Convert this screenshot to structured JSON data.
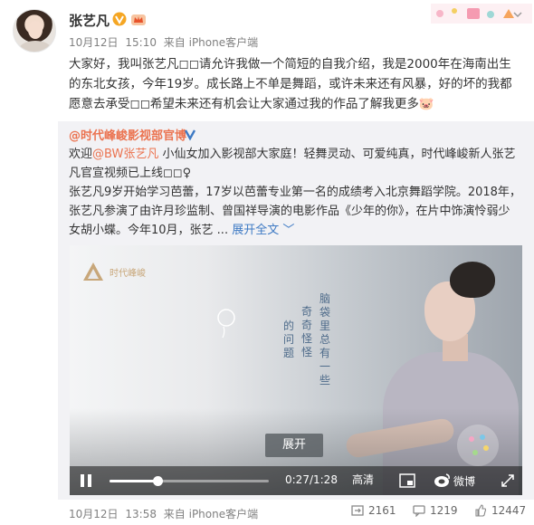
{
  "post": {
    "user_name": "张艺凡",
    "date": "10月12日",
    "time": "15:10",
    "source": "来自 iPhone客户端",
    "text": "大家好，我叫张艺凡◻◻请允许我做一个简短的自我介绍，我是2000年在海南出生的东北女孩，今年19岁。成长路上不单是舞蹈，或许未来还有风暴，好的坏的我都愿意去承受◻◻希望未来还有机会让大家通过我的作品了解我更多🐷"
  },
  "repost": {
    "author": "@时代峰峻影视部官博",
    "line1_prefix": "欢迎",
    "line1_mention": "@BW张艺凡",
    "line1_suffix": " 小仙女加入影视部大家庭！轻舞灵动、可爱纯真，时代峰峻新人张艺凡官宣视频已上线◻◻♀",
    "body_text": "张艺凡9岁开始学习芭蕾，17岁以芭蕾专业第一名的成绩考入北京舞蹈学院。2018年，张艺凡参演了由许月珍监制、曾国祥导演的电影作品《少年的你》，在片中饰演怜弱少女胡小蝶。今年10月，张艺 ...",
    "expand_link": "展开全文",
    "expand_chevron": "﹀"
  },
  "video": {
    "logo_text": "时代峰峻",
    "poem_col1": "脑袋里总有一些",
    "poem_col2": "奇奇怪怪",
    "poem_col3": "的问题",
    "poem_col4": "",
    "expand_button": "展开",
    "progress_fraction": 0.3,
    "current_time": "0:27",
    "total_time": "1:28",
    "quality": "高清",
    "brand": "微博"
  },
  "footer": {
    "date": "10月12日",
    "time": "13:58",
    "source": "来自 iPhone客户端",
    "repost_count": "2161",
    "comment_count": "1219",
    "like_count": "12447"
  },
  "colors": {
    "accent": "#eb7350",
    "link_blue": "#3e7ac4",
    "verified": "#f5a623"
  },
  "icons": [
    "verified-badge-icon",
    "vip-crown-icon",
    "more-chevron-icon",
    "play-icon",
    "pip-icon",
    "weibo-logo-icon",
    "fullscreen-icon",
    "repost-icon",
    "comment-icon",
    "like-icon"
  ]
}
